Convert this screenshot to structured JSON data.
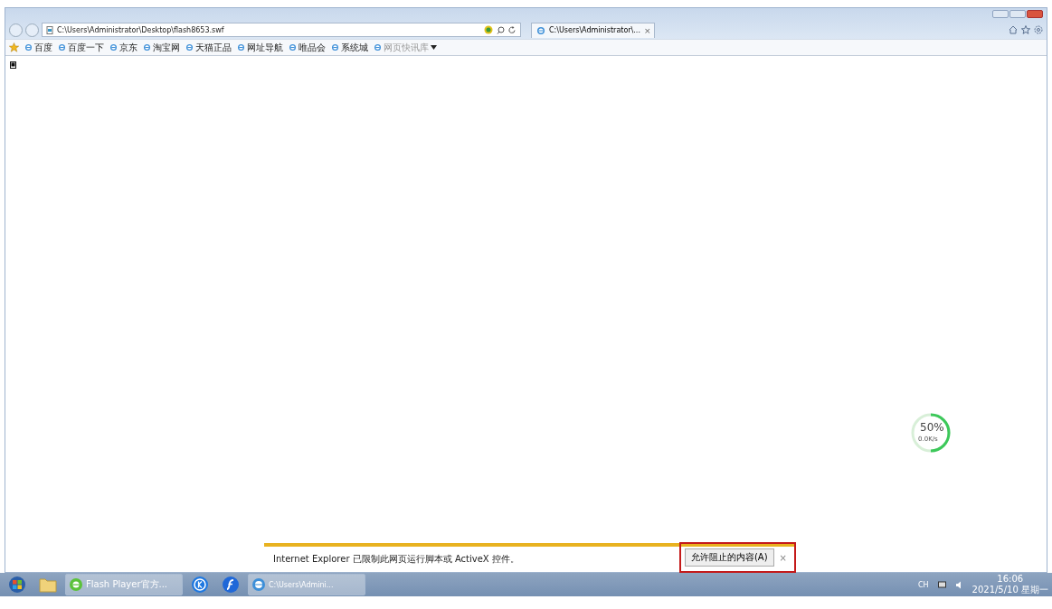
{
  "window": {
    "controls": [
      {
        "kind": "minimize"
      },
      {
        "kind": "maximize"
      },
      {
        "kind": "close"
      }
    ]
  },
  "address_bar": {
    "url": "C:\\Users\\Administrator\\Desktop\\flash8653.swf"
  },
  "tab": {
    "title": "C:\\Users\\Administrator\\...",
    "close": "×",
    "selected": true
  },
  "favorites": [
    {
      "label": "百度",
      "disabled": false
    },
    {
      "label": "百度一下",
      "disabled": false
    },
    {
      "label": "京东",
      "disabled": false
    },
    {
      "label": "淘宝网",
      "disabled": false
    },
    {
      "label": "天猫正品",
      "disabled": false
    },
    {
      "label": "网址导航",
      "disabled": false
    },
    {
      "label": "唯品会",
      "disabled": false
    },
    {
      "label": "系统城",
      "disabled": false
    },
    {
      "label": "网页快讯库",
      "disabled": true
    }
  ],
  "speed_meter": {
    "level": 0.5,
    "percent": "50%",
    "speed": "0.0K/s"
  },
  "notification": {
    "message": "Internet Explorer 已限制此网页运行脚本或 ActiveX 控件。",
    "button": "允许阻止的内容(A)",
    "close": "×",
    "highlighted": true
  },
  "taskbar": {
    "items": [
      {
        "kind": "start"
      },
      {
        "kind": "folder"
      },
      {
        "kind": "window",
        "label": "Flash Player官方..."
      },
      {
        "kind": "k-app"
      },
      {
        "kind": "flash"
      },
      {
        "kind": "window-ie",
        "label": "C:\\Users\\Admini..."
      }
    ],
    "tray": {
      "language": "CH",
      "time": "16:06",
      "date": "2021/5/10 星期一"
    }
  }
}
